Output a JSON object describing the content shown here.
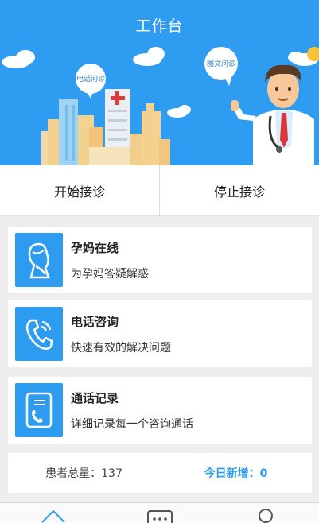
{
  "header": {
    "title": "工作台",
    "bubble_phone": "电话问诊",
    "bubble_text": "图文问诊"
  },
  "actions": {
    "start_label": "开始接诊",
    "stop_label": "停止接诊"
  },
  "cards": [
    {
      "title": "孕妈在线",
      "desc": "为孕妈答疑解惑",
      "icon": "pregnant-woman-icon"
    },
    {
      "title": "电话咨询",
      "desc": "快速有效的解决问题",
      "icon": "phone-icon"
    },
    {
      "title": "通话记录",
      "desc": "详细记录每一个咨询通话",
      "icon": "call-log-icon"
    }
  ],
  "stats": {
    "total_label": "患者总量：",
    "total_value": "137",
    "today_label": "今日新增：",
    "today_value": "0"
  },
  "tabbar": {
    "icons": [
      "home-icon",
      "message-icon",
      "profile-icon"
    ]
  },
  "colors": {
    "primary": "#2e9cf0",
    "background": "#eeeeee",
    "accent_text": "#2a9af0"
  }
}
